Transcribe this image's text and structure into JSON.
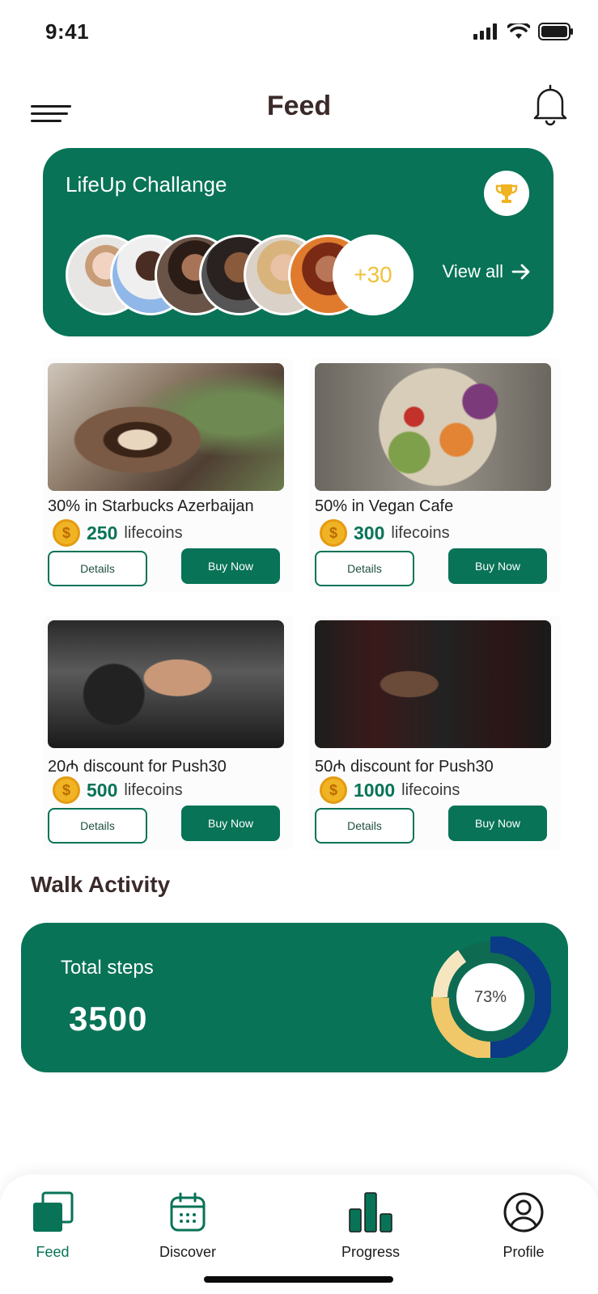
{
  "status": {
    "time": "9:41"
  },
  "header": {
    "title": "Feed"
  },
  "challenge": {
    "title": "LifeUp Challange",
    "more_count": "+30",
    "view_all": "View all"
  },
  "offers": [
    {
      "title": "30% in Starbucks Azerbaijan",
      "price": "250",
      "unit": "lifecoins",
      "details": "Details",
      "buy": "Buy Now"
    },
    {
      "title": "50% in Vegan Cafe",
      "price": "300",
      "unit": "lifecoins",
      "details": "Details",
      "buy": "Buy Now"
    },
    {
      "title": "20₼ discount for Push30",
      "price": "500",
      "unit": "lifecoins",
      "details": "Details",
      "buy": "Buy Now"
    },
    {
      "title": "50₼ discount for Push30",
      "price": "1000",
      "unit": "lifecoins",
      "details": "Details",
      "buy": "Buy Now"
    }
  ],
  "walk": {
    "section_title": "Walk Activity",
    "label": "Total steps",
    "value": "3500",
    "percent_label": "73%",
    "percent": 73
  },
  "tabs": [
    {
      "label": "Feed",
      "icon": "feed-icon"
    },
    {
      "label": "Discover",
      "icon": "calendar-icon"
    },
    {
      "label": "Progress",
      "icon": "bar-chart-icon"
    },
    {
      "label": "Profile",
      "icon": "user-icon"
    }
  ],
  "colors": {
    "primary": "#087357",
    "title": "#3b2a2a",
    "coin": "#f0b323",
    "accent_yellow": "#f0c23a",
    "donut_navy": "#0b3a86"
  }
}
